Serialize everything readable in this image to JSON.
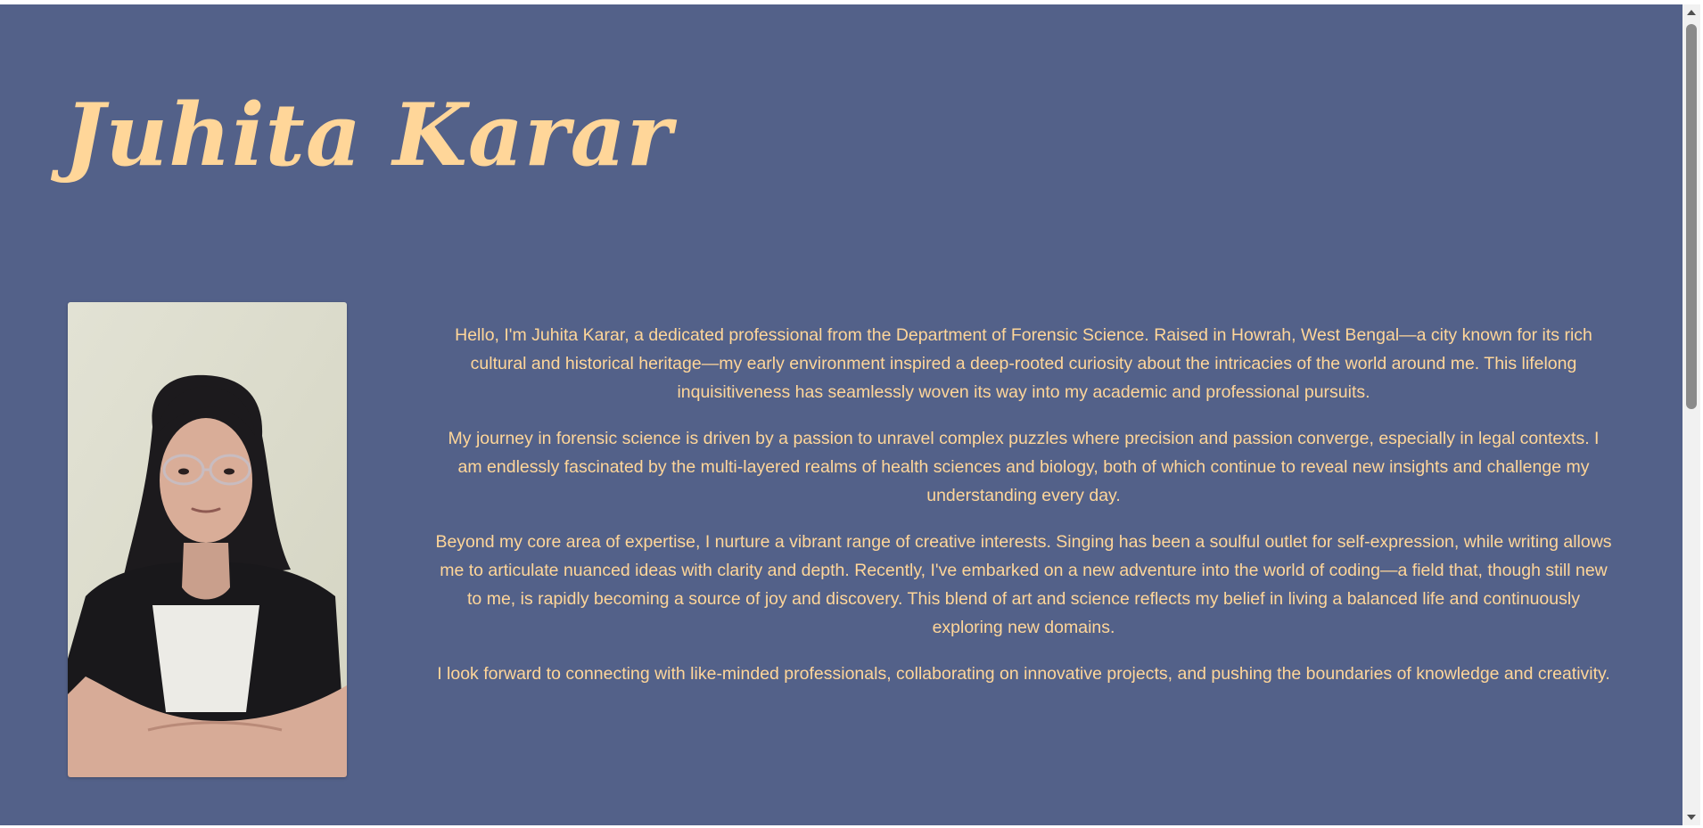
{
  "header": {
    "name": "Juhita Karar"
  },
  "profile_photo": {
    "alt": "Juhita Karar"
  },
  "bio": {
    "paragraphs": [
      "Hello, I'm Juhita Karar, a dedicated professional from the Department of Forensic Science. Raised in Howrah, West Bengal—a city known for its rich cultural and historical heritage—my early environment inspired a deep-rooted curiosity about the intricacies of the world around me. This lifelong inquisitiveness has seamlessly woven its way into my academic and professional pursuits.",
      "My journey in forensic science is driven by a passion to unravel complex puzzles where precision and passion converge, especially in legal contexts. I am endlessly fascinated by the multi-layered realms of health sciences and biology, both of which continue to reveal new insights and challenge my understanding every day.",
      "Beyond my core area of expertise, I nurture a vibrant range of creative interests. Singing has been a soulful outlet for self-expression, while writing allows me to articulate nuanced ideas with clarity and depth. Recently, I've embarked on a new adventure into the world of coding—a field that, though still new to me, is rapidly becoming a source of joy and discovery. This blend of art and science reflects my belief in living a balanced life and continuously exploring new domains.",
      "I look forward to connecting with like-minded professionals, collaborating on innovative projects, and pushing the boundaries of knowledge and creativity."
    ]
  },
  "colors": {
    "background": "#536189",
    "accent_text": "#ffd699"
  }
}
